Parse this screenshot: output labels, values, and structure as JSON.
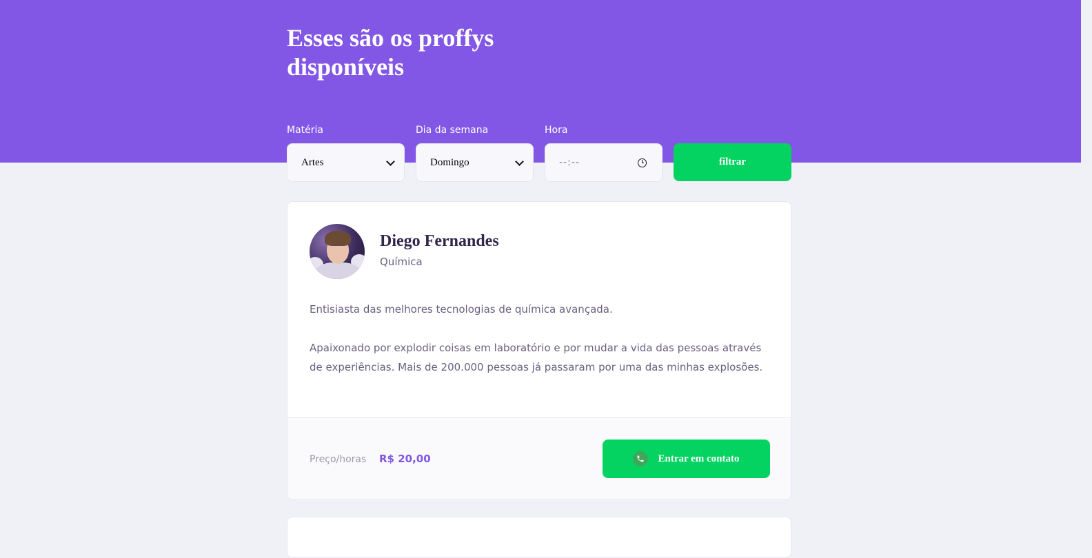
{
  "header": {
    "title": "Esses são os proffys disponíveis"
  },
  "filters": {
    "subject": {
      "label": "Matéria",
      "value": "Artes"
    },
    "weekday": {
      "label": "Dia da semana",
      "value": "Domingo"
    },
    "time": {
      "label": "Hora",
      "placeholder": "--:--"
    },
    "submit_label": "filtrar"
  },
  "teachers": [
    {
      "name": "Diego Fernandes",
      "subject": "Química",
      "bio": "Entisiasta das melhores tecnologias de química avançada.\n\nApaixonado por explodir coisas em laboratório e por mudar a vida das pessoas através de experiências. Mais de 200.000 pessoas já passaram por uma das minhas explosões.",
      "price_label": "Preço/horas",
      "price": "R$ 20,00",
      "contact_label": "Entrar em contato"
    }
  ],
  "icons": {
    "select_arrow": "chevron-down-icon",
    "time": "clock-icon",
    "contact": "whatsapp-icon"
  },
  "colors": {
    "primary": "#8257E5",
    "secondary": "#04D361",
    "background": "#F0F0F7",
    "title_text": "#32264D",
    "body_text": "#6A6180"
  }
}
